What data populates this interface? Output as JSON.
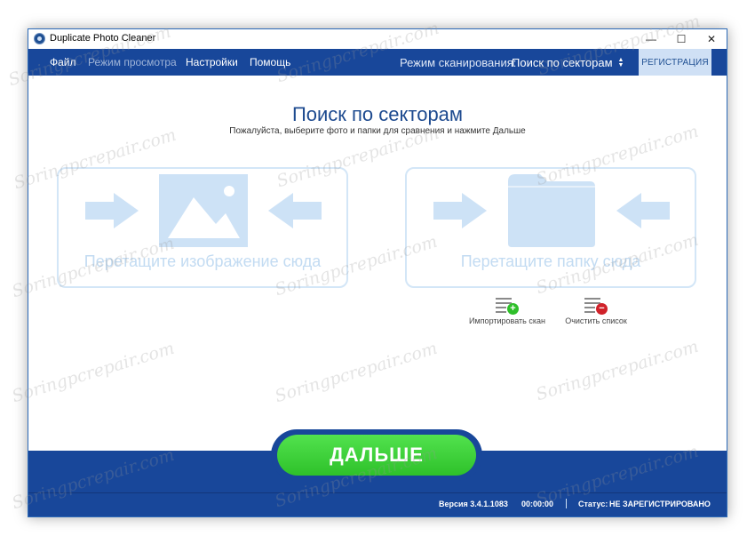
{
  "window": {
    "title": "Duplicate Photo Cleaner",
    "controls": {
      "minimize": "—",
      "maximize": "☐",
      "close": "✕"
    }
  },
  "menu": {
    "items": [
      {
        "label": "Файл",
        "enabled": true
      },
      {
        "label": "Режим просмотра",
        "enabled": false
      },
      {
        "label": "Настройки",
        "enabled": true
      },
      {
        "label": "Помощь",
        "enabled": true
      }
    ],
    "scan_mode_label": "Режим сканирования:",
    "scan_mode_value": "Поиск по секторам",
    "register_label": "РЕГИСТРАЦИЯ"
  },
  "main": {
    "title": "Поиск по секторам",
    "subtitle": "Пожалуйста, выберите фото и папки для сравнения и нажмите Дальше",
    "drop_image_label": "Перетащите изображение сюда",
    "drop_folder_label": "Перетащите папку сюда",
    "import_scan_label": "Импортировать скан",
    "clear_list_label": "Очистить список",
    "next_label": "ДАЛЬШЕ"
  },
  "status_bar": {
    "version": "Версия 3.4.1.1083",
    "time": "00:00:00",
    "status_label": "Статус:",
    "status_value": "НЕ ЗАРЕГИСТРИРОВАНО"
  },
  "watermark_text": "Soringpcrepair.com",
  "colors": {
    "accent_blue": "#18479a",
    "light_blue": "#cfe0f5",
    "next_green": "#3fd23a",
    "add_green": "#2fbf2a",
    "remove_red": "#d0222a"
  }
}
